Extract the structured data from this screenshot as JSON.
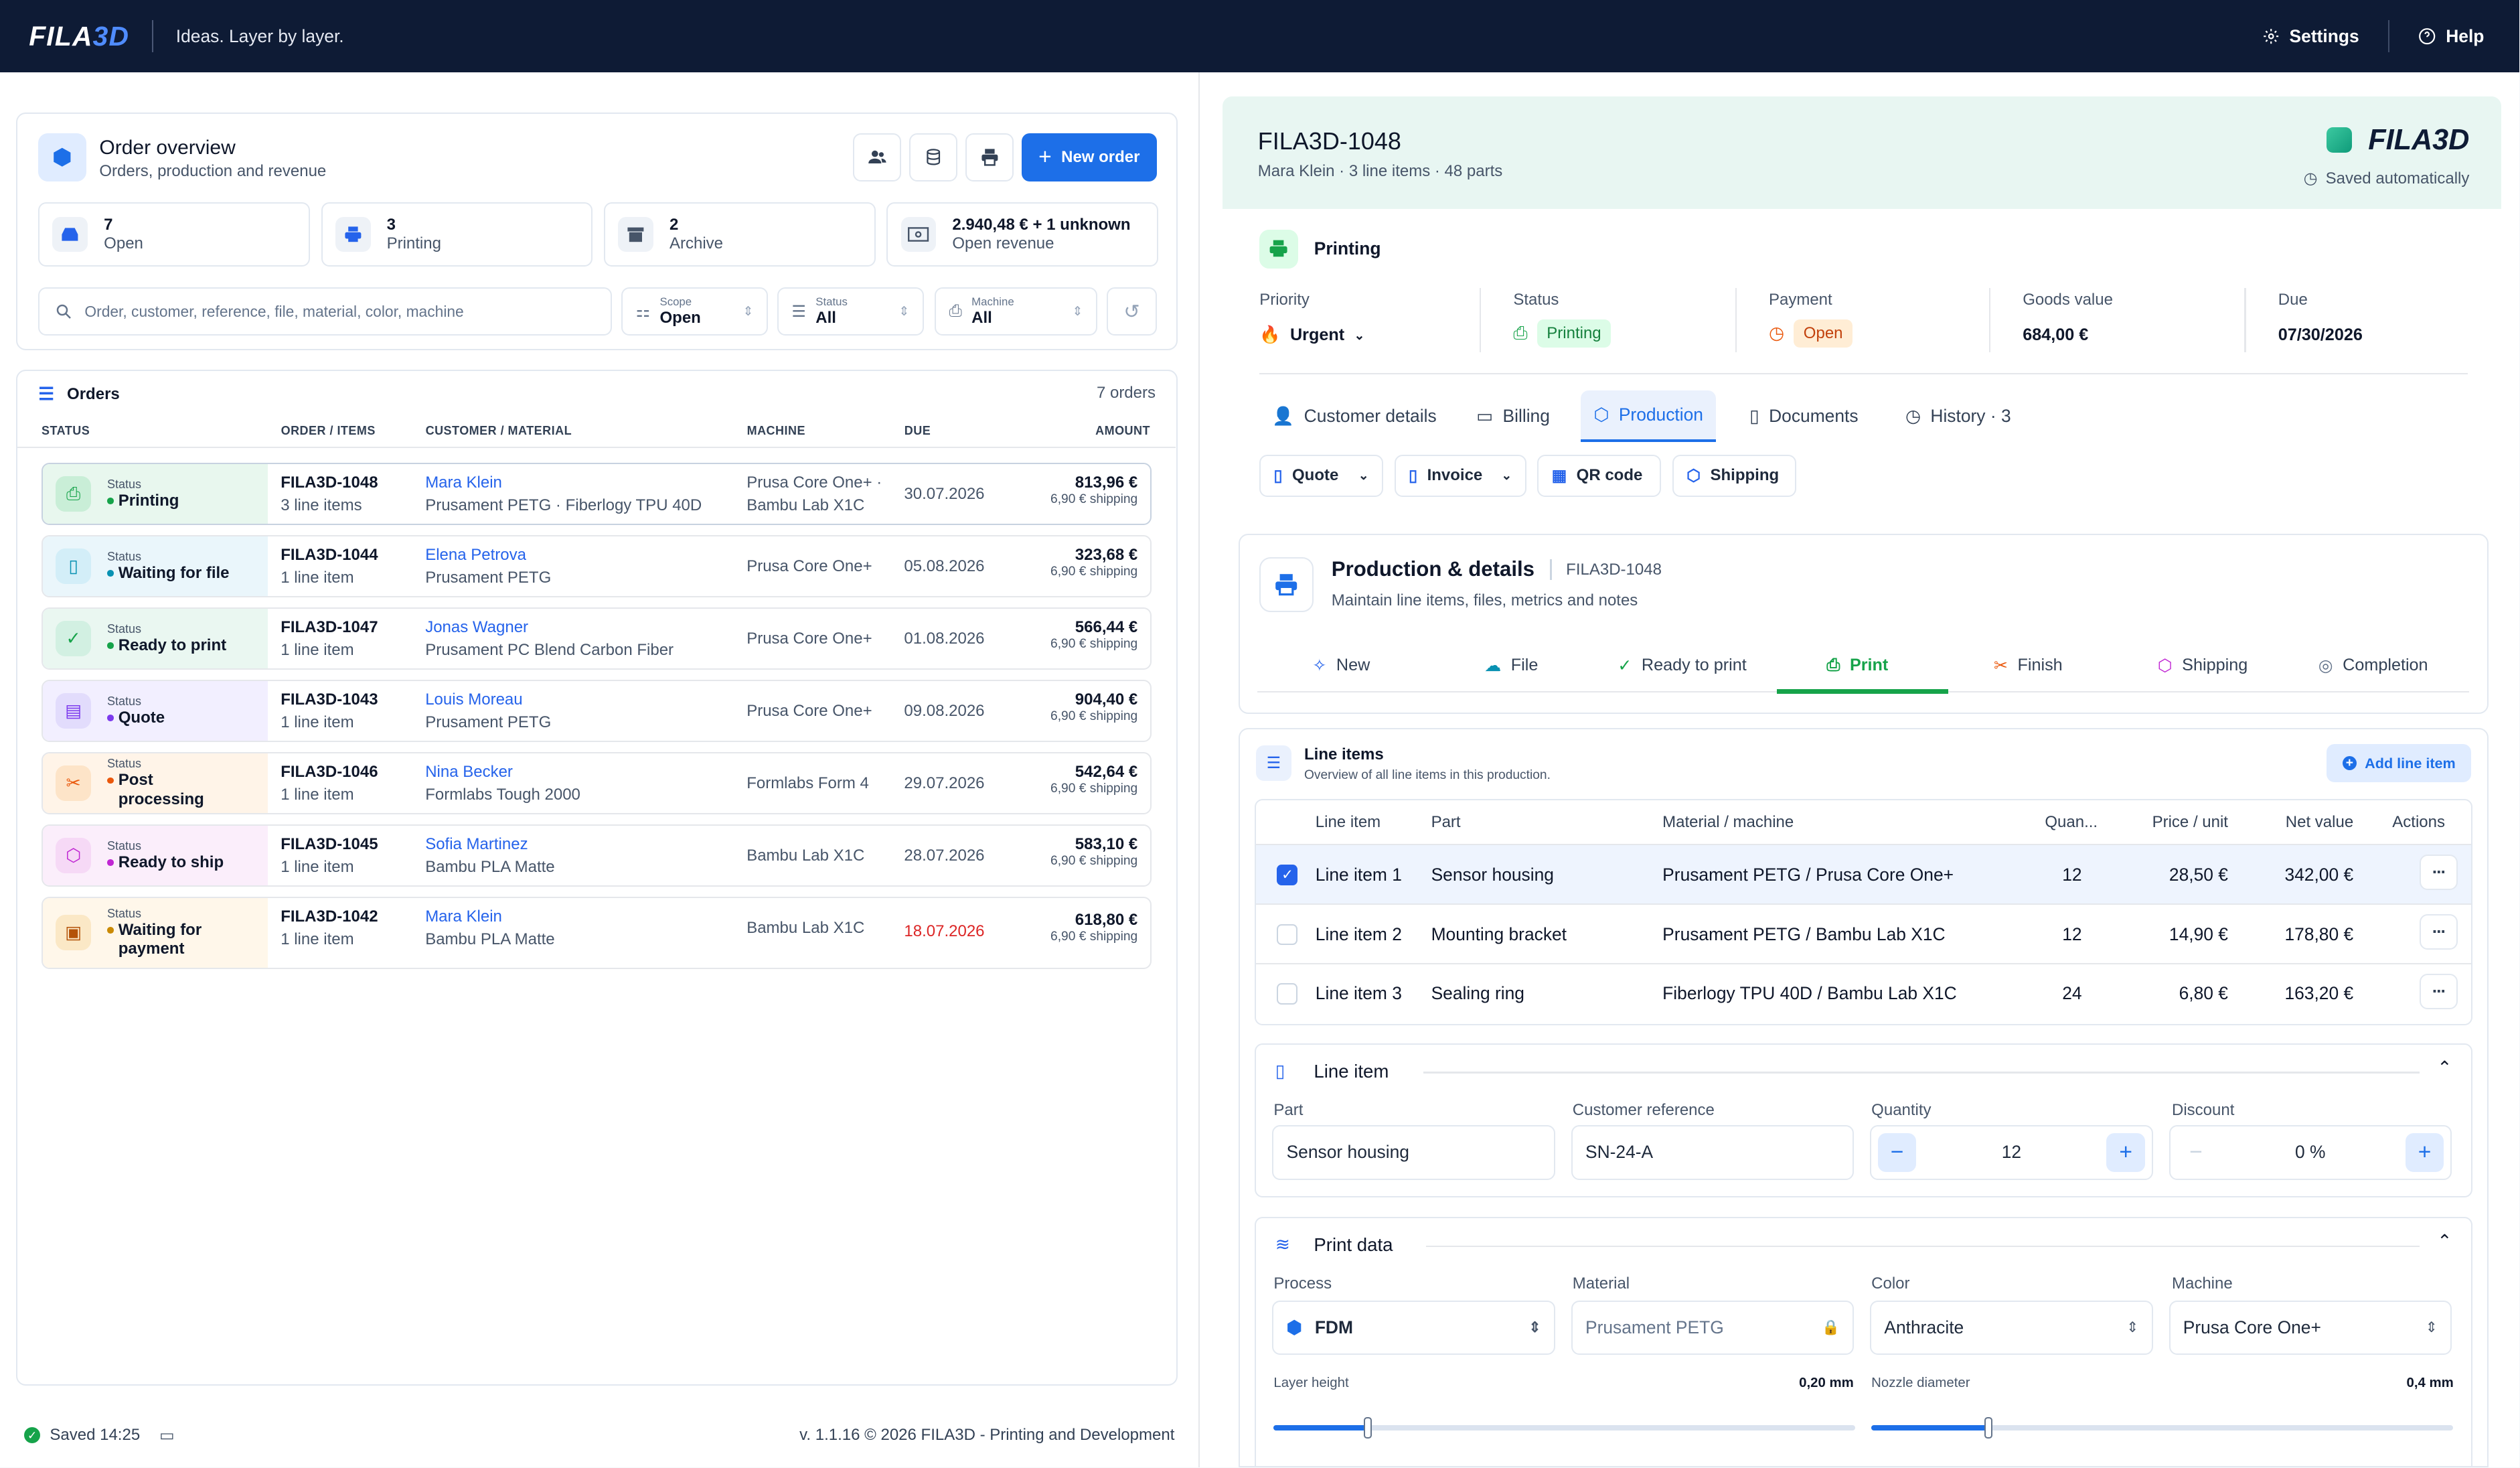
{
  "topbar": {
    "logo_a": "FILA",
    "logo_b": "3D",
    "tagline": "Ideas. Layer by layer.",
    "settings": "Settings",
    "help": "Help"
  },
  "overview": {
    "title": "Order overview",
    "subtitle": "Orders, production and revenue",
    "new_order": "New order",
    "stats": [
      {
        "num": "7",
        "label": "Open"
      },
      {
        "num": "3",
        "label": "Printing"
      },
      {
        "num": "2",
        "label": "Archive"
      },
      {
        "num": "2.940,48 € + 1 unknown",
        "label": "Open revenue"
      }
    ],
    "search_placeholder": "Order, customer, reference, file, material, color, machine",
    "filters": [
      {
        "key": "Scope",
        "value": "Open"
      },
      {
        "key": "Status",
        "value": "All"
      },
      {
        "key": "Machine",
        "value": "All"
      }
    ]
  },
  "orders": {
    "title": "Orders",
    "count": "7 orders",
    "headers": [
      "STATUS",
      "ORDER / ITEMS",
      "CUSTOMER / MATERIAL",
      "MACHINE",
      "DUE",
      "AMOUNT"
    ],
    "status_label": "Status",
    "rows": [
      {
        "status": "Printing",
        "id": "FILA3D-1048",
        "items": "3 line items",
        "customer": "Mara Klein",
        "material": "Prusament PETG · Fiberlogy TPU 40D",
        "machine1": "Prusa Core One+ ·",
        "machine2": "Bambu Lab X1C",
        "due": "30.07.2026",
        "amount": "813,96 €",
        "shipping": "6,90 € shipping"
      },
      {
        "status": "Waiting for file",
        "id": "FILA3D-1044",
        "items": "1 line item",
        "customer": "Elena Petrova",
        "material": "Prusament PETG",
        "machine1": "Prusa Core One+",
        "machine2": "",
        "due": "05.08.2026",
        "amount": "323,68 €",
        "shipping": "6,90 € shipping"
      },
      {
        "status": "Ready to print",
        "id": "FILA3D-1047",
        "items": "1 line item",
        "customer": "Jonas Wagner",
        "material": "Prusament PC Blend Carbon Fiber",
        "machine1": "Prusa Core One+",
        "machine2": "",
        "due": "01.08.2026",
        "amount": "566,44 €",
        "shipping": "6,90 € shipping"
      },
      {
        "status": "Quote",
        "id": "FILA3D-1043",
        "items": "1 line item",
        "customer": "Louis Moreau",
        "material": "Prusament PETG",
        "machine1": "Prusa Core One+",
        "machine2": "",
        "due": "09.08.2026",
        "amount": "904,40 €",
        "shipping": "6,90 € shipping"
      },
      {
        "status": "Post processing",
        "id": "FILA3D-1046",
        "items": "1 line item",
        "customer": "Nina Becker",
        "material": "Formlabs Tough 2000",
        "machine1": "Formlabs Form 4",
        "machine2": "",
        "due": "29.07.2026",
        "amount": "542,64 €",
        "shipping": "6,90 € shipping"
      },
      {
        "status": "Ready to ship",
        "id": "FILA3D-1045",
        "items": "1 line item",
        "customer": "Sofia Martinez",
        "material": "Bambu PLA Matte",
        "machine1": "Bambu Lab X1C",
        "machine2": "",
        "due": "28.07.2026",
        "amount": "583,10 €",
        "shipping": "6,90 € shipping"
      },
      {
        "status": "Waiting for payment",
        "id": "FILA3D-1042",
        "items": "1 line item",
        "customer": "Mara Klein",
        "material": "Bambu PLA Matte",
        "machine1": "Bambu Lab X1C",
        "machine2": "",
        "due": "18.07.2026",
        "amount": "618,80 €",
        "shipping": "6,90 € shipping"
      }
    ]
  },
  "footer": {
    "saved": "Saved 14:25",
    "version": "v. 1.1.16 © 2026 FILA3D - Printing and Development"
  },
  "detail": {
    "id": "FILA3D-1048",
    "sub": "Mara Klein · 3 line items · 48 parts",
    "saved": "Saved automatically",
    "state": "Printing",
    "fields": [
      {
        "label": "Priority",
        "value": "Urgent"
      },
      {
        "label": "Status",
        "value": "Printing"
      },
      {
        "label": "Payment",
        "value": "Open"
      },
      {
        "label": "Goods value",
        "value": "684,00 €"
      },
      {
        "label": "Due",
        "value": "07/30/2026"
      }
    ],
    "tabs": [
      "Customer details",
      "Billing",
      "Production",
      "Documents",
      "History · 3"
    ],
    "pills": [
      "Quote",
      "Invoice",
      "QR code",
      "Shipping"
    ],
    "prod_title": "Production & details",
    "prod_id": "FILA3D-1048",
    "prod_sub": "Maintain line items, files, metrics and notes",
    "steps": [
      "New",
      "File",
      "Ready to print",
      "Print",
      "Finish",
      "Shipping",
      "Completion"
    ],
    "li_title": "Line items",
    "li_sub": "Overview of all line items in this production.",
    "add_li": "Add line item",
    "li_headers": [
      "Line item",
      "Part",
      "Material / machine",
      "Quan...",
      "Price / unit",
      "Net value",
      "Actions"
    ],
    "li_rows": [
      {
        "name": "Line item 1",
        "part": "Sensor housing",
        "mat": "Prusament PETG / Prusa Core One+",
        "qty": "12",
        "price": "28,50 €",
        "net": "342,00 €"
      },
      {
        "name": "Line item 2",
        "part": "Mounting bracket",
        "mat": "Prusament PETG / Bambu Lab X1C",
        "qty": "12",
        "price": "14,90 €",
        "net": "178,80 €"
      },
      {
        "name": "Line item 3",
        "part": "Sealing ring",
        "mat": "Fiberlogy TPU 40D / Bambu Lab X1C",
        "qty": "24",
        "price": "6,80 €",
        "net": "163,20 €"
      }
    ],
    "line_item": {
      "title": "Line item",
      "part_l": "Part",
      "part_v": "Sensor housing",
      "ref_l": "Customer reference",
      "ref_v": "SN-24-A",
      "qty_l": "Quantity",
      "qty_v": "12",
      "disc_l": "Discount",
      "disc_v": "0 %"
    },
    "print": {
      "title": "Print data",
      "process_l": "Process",
      "process_v": "FDM",
      "mat_l": "Material",
      "mat_v": "Prusament PETG",
      "color_l": "Color",
      "color_v": "Anthracite",
      "mach_l": "Machine",
      "mach_v": "Prusa Core One+",
      "lh_l": "Layer height",
      "lh_v": "0,20 mm",
      "nd_l": "Nozzle diameter",
      "nd_v": "0,4 mm",
      "lh_level": 0.16,
      "nd_level": 0.2
    }
  },
  "colors": {
    "accent": "#1d6fe8",
    "green": "#16a34a",
    "topbar": "#0e1b35",
    "red": "#dc2626"
  }
}
